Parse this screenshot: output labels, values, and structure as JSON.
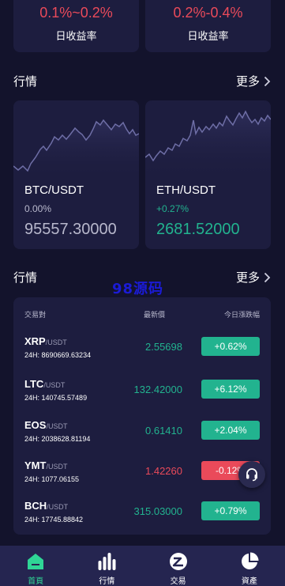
{
  "yield_cards": [
    {
      "value": "0.1%~0.2%",
      "label": "日收益率"
    },
    {
      "value": "0.2%-0.4%",
      "label": "日收益率"
    }
  ],
  "market_section": {
    "title": "行情",
    "more": "更多"
  },
  "market_cards": [
    {
      "pair": "BTC/USDT",
      "change": "0.00%",
      "price": "95557.30000",
      "trend": "flat"
    },
    {
      "pair": "ETH/USDT",
      "change": "+0.27%",
      "price": "2681.52000",
      "trend": "up"
    }
  ],
  "table_section": {
    "title": "行情",
    "more": "更多"
  },
  "watermark": "98源码",
  "table": {
    "headers": {
      "pair": "交易對",
      "price": "最新價",
      "change": "今日漲跌幅"
    },
    "rows": [
      {
        "symbol": "XRP",
        "quote": "/USDT",
        "volume": "24H: 8690669.63234",
        "price": "2.55698",
        "change": "+0.62%",
        "direction": "up"
      },
      {
        "symbol": "LTC",
        "quote": "/USDT",
        "volume": "24H: 140745.57489",
        "price": "132.42000",
        "change": "+6.12%",
        "direction": "up"
      },
      {
        "symbol": "EOS",
        "quote": "/USDT",
        "volume": "24H: 2038628.81194",
        "price": "0.61410",
        "change": "+2.04%",
        "direction": "up"
      },
      {
        "symbol": "YMT",
        "quote": "/USDT",
        "volume": "24H: 1077.06155",
        "price": "1.42260",
        "change": "-0.12%",
        "direction": "down"
      },
      {
        "symbol": "BCH",
        "quote": "/USDT",
        "volume": "24H: 17745.88842",
        "price": "315.03000",
        "change": "+0.79%",
        "direction": "up"
      }
    ]
  },
  "nav": [
    {
      "label": "首頁",
      "icon": "home-icon",
      "active": true
    },
    {
      "label": "行情",
      "icon": "bar-chart-icon",
      "active": false
    },
    {
      "label": "交易",
      "icon": "trade-icon",
      "active": false
    },
    {
      "label": "資產",
      "icon": "pie-chart-icon",
      "active": false
    }
  ],
  "colors": {
    "up": "#22b38f",
    "down": "#ea4a5a",
    "active_nav": "#2fd696",
    "background": "#13132c",
    "card": "#1d1d3f"
  }
}
